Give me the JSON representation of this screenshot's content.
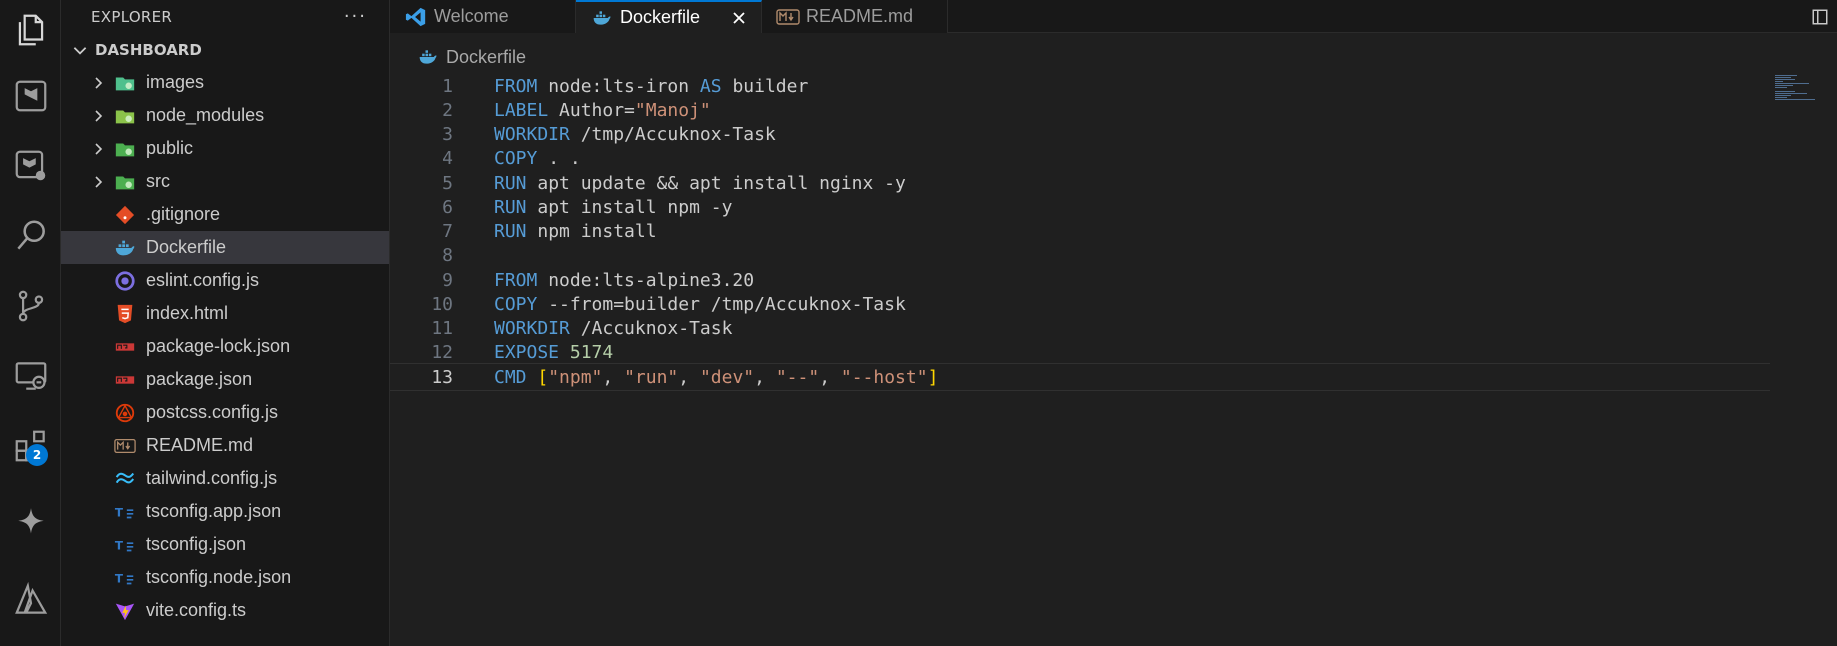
{
  "sidebar": {
    "title": "EXPLORER",
    "more": "···",
    "section": "DASHBOARD",
    "items": [
      {
        "label": "images",
        "type": "folder",
        "icon": "images-folder-icon",
        "color": "#4fc08d"
      },
      {
        "label": "node_modules",
        "type": "folder",
        "icon": "node-modules-folder-icon",
        "color": "#8bc34a"
      },
      {
        "label": "public",
        "type": "folder",
        "icon": "public-folder-icon",
        "color": "#4caf50"
      },
      {
        "label": "src",
        "type": "folder",
        "icon": "src-folder-icon",
        "color": "#4caf50"
      },
      {
        "label": ".gitignore",
        "type": "file",
        "icon": "git-icon",
        "color": "#e44d26"
      },
      {
        "label": "Dockerfile",
        "type": "file",
        "icon": "docker-icon",
        "color": "#4ea7d8",
        "selected": true
      },
      {
        "label": "eslint.config.js",
        "type": "file",
        "icon": "eslint-icon",
        "color": "#7c6fe0"
      },
      {
        "label": "index.html",
        "type": "file",
        "icon": "html5-icon",
        "color": "#e44d26"
      },
      {
        "label": "package-lock.json",
        "type": "file",
        "icon": "npm-icon",
        "color": "#cb3837"
      },
      {
        "label": "package.json",
        "type": "file",
        "icon": "npm-icon",
        "color": "#cb3837"
      },
      {
        "label": "postcss.config.js",
        "type": "file",
        "icon": "postcss-icon",
        "color": "#dd3a0a"
      },
      {
        "label": "README.md",
        "type": "file",
        "icon": "markdown-icon",
        "color": "#b08b6c"
      },
      {
        "label": "tailwind.config.js",
        "type": "file",
        "icon": "tailwind-icon",
        "color": "#38bdf8"
      },
      {
        "label": "tsconfig.app.json",
        "type": "file",
        "icon": "tsconfig-icon",
        "color": "#3178c6"
      },
      {
        "label": "tsconfig.json",
        "type": "file",
        "icon": "tsconfig-icon",
        "color": "#3178c6"
      },
      {
        "label": "tsconfig.node.json",
        "type": "file",
        "icon": "tsconfig-icon",
        "color": "#3178c6"
      },
      {
        "label": "vite.config.ts",
        "type": "file",
        "icon": "vite-icon",
        "color": "#a855f7"
      }
    ]
  },
  "activity": {
    "extensions_badge": "2",
    "icons": [
      "explorer-icon",
      "terraform-icon",
      "terraform-cloud-icon",
      "search-icon",
      "source-control-icon",
      "remote-explorer-icon",
      "extensions-icon",
      "copilot-icon",
      "azure-icon"
    ]
  },
  "tabs": [
    {
      "label": "Welcome",
      "icon": "vscode-icon",
      "active": false
    },
    {
      "label": "Dockerfile",
      "icon": "docker-icon",
      "active": true
    },
    {
      "label": "README.md",
      "icon": "markdown-icon",
      "active": false
    }
  ],
  "breadcrumb": {
    "file": "Dockerfile"
  },
  "editor": {
    "current_line": 13,
    "lines": [
      {
        "n": "1",
        "tokens": [
          {
            "t": "FROM",
            "c": "kw"
          },
          {
            "t": " node:lts-iron ",
            "c": ""
          },
          {
            "t": "AS",
            "c": "kw"
          },
          {
            "t": " builder",
            "c": ""
          }
        ]
      },
      {
        "n": "2",
        "tokens": [
          {
            "t": "LABEL",
            "c": "kw"
          },
          {
            "t": " Author=",
            "c": ""
          },
          {
            "t": "\"Manoj\"",
            "c": "str"
          }
        ]
      },
      {
        "n": "3",
        "tokens": [
          {
            "t": "WORKDIR",
            "c": "kw"
          },
          {
            "t": " /tmp/Accuknox-Task",
            "c": ""
          }
        ]
      },
      {
        "n": "4",
        "tokens": [
          {
            "t": "COPY",
            "c": "kw"
          },
          {
            "t": " . .",
            "c": ""
          }
        ]
      },
      {
        "n": "5",
        "tokens": [
          {
            "t": "RUN",
            "c": "kw"
          },
          {
            "t": " apt update && apt install nginx -y",
            "c": ""
          }
        ]
      },
      {
        "n": "6",
        "tokens": [
          {
            "t": "RUN",
            "c": "kw"
          },
          {
            "t": " apt install npm -y",
            "c": ""
          }
        ]
      },
      {
        "n": "7",
        "tokens": [
          {
            "t": "RUN",
            "c": "kw"
          },
          {
            "t": " npm install",
            "c": ""
          }
        ]
      },
      {
        "n": "8",
        "tokens": []
      },
      {
        "n": "9",
        "tokens": [
          {
            "t": "FROM",
            "c": "kw"
          },
          {
            "t": " node:lts-alpine3.20",
            "c": ""
          }
        ]
      },
      {
        "n": "10",
        "tokens": [
          {
            "t": "COPY",
            "c": "kw"
          },
          {
            "t": " --from=builder /tmp/Accuknox-Task",
            "c": ""
          }
        ]
      },
      {
        "n": "11",
        "tokens": [
          {
            "t": "WORKDIR",
            "c": "kw"
          },
          {
            "t": " /Accuknox-Task",
            "c": ""
          }
        ]
      },
      {
        "n": "12",
        "tokens": [
          {
            "t": "EXPOSE",
            "c": "kw"
          },
          {
            "t": " ",
            "c": ""
          },
          {
            "t": "5174",
            "c": "num"
          }
        ]
      },
      {
        "n": "13",
        "tokens": [
          {
            "t": "CMD",
            "c": "kw"
          },
          {
            "t": " ",
            "c": ""
          },
          {
            "t": "[",
            "c": "br"
          },
          {
            "t": "\"npm\"",
            "c": "str"
          },
          {
            "t": ", ",
            "c": ""
          },
          {
            "t": "\"run\"",
            "c": "str"
          },
          {
            "t": ", ",
            "c": ""
          },
          {
            "t": "\"dev\"",
            "c": "str"
          },
          {
            "t": ", ",
            "c": ""
          },
          {
            "t": "\"--\"",
            "c": "str"
          },
          {
            "t": ", ",
            "c": ""
          },
          {
            "t": "\"--host\"",
            "c": "str"
          },
          {
            "t": "]",
            "c": "br"
          }
        ]
      }
    ]
  },
  "colors": {
    "accent": "#0078d4",
    "keyword": "#569cd6",
    "string": "#ce9178",
    "number": "#b5cea8",
    "bracket": "#ffd700"
  }
}
